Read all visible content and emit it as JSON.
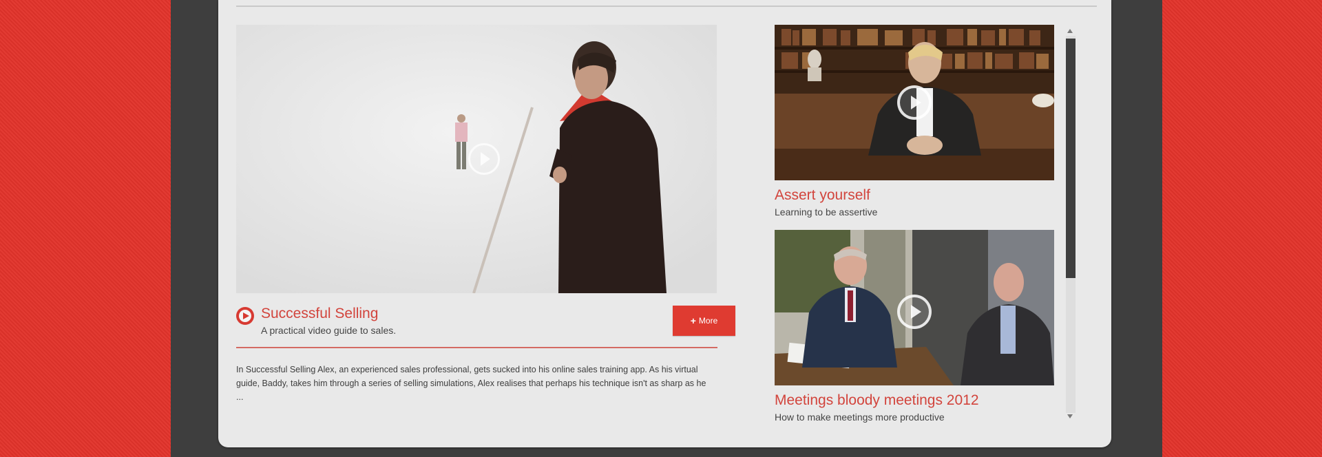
{
  "featured": {
    "title": "Successful Selling",
    "subtitle": "A practical video guide to sales.",
    "more_label": "More",
    "description": "In Successful Selling Alex, an experienced sales professional, gets sucked into his online sales training app. As his virtual guide, Baddy, takes him through a series of selling simulations, Alex realises that perhaps his technique isn't as sharp as he ..."
  },
  "side_videos": [
    {
      "title": "Assert yourself",
      "subtitle": "Learning to be assertive"
    },
    {
      "title": "Meetings bloody meetings 2012",
      "subtitle": "How to make meetings more productive"
    }
  ],
  "colors": {
    "brand_red": "#e2332b",
    "title_red": "#d2443c",
    "frame_dark": "#3e3e3e",
    "panel_bg": "#e9e9e9"
  },
  "icons": {
    "featured_play": "play-circle-icon",
    "more": "plus-icon",
    "thumb_play": "play-icon"
  }
}
